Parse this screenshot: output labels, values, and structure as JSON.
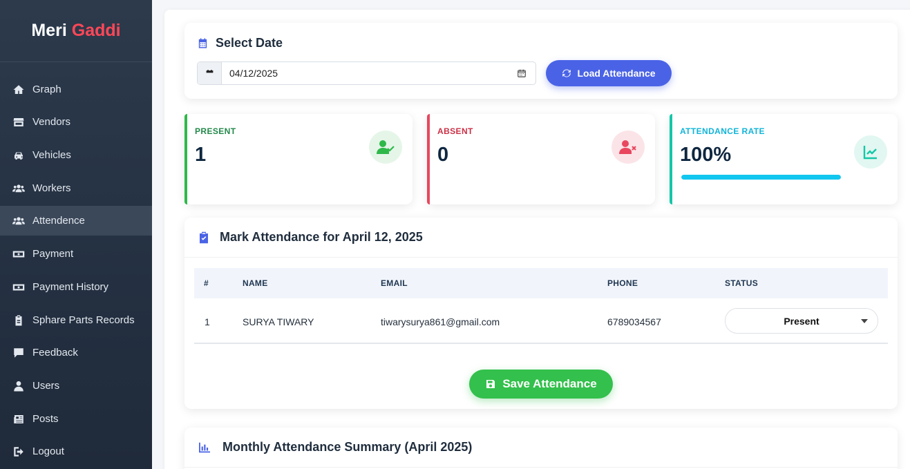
{
  "sidebar": {
    "brand_main": "Meri",
    "brand_accent": "Gaddi",
    "items": [
      {
        "label": "Graph",
        "icon": "home-icon"
      },
      {
        "label": "Vendors",
        "icon": "store-icon"
      },
      {
        "label": "Vehicles",
        "icon": "car-icon"
      },
      {
        "label": "Workers",
        "icon": "users-icon"
      },
      {
        "label": "Attendence",
        "icon": "users-icon",
        "active": true
      },
      {
        "label": "Payment",
        "icon": "money-icon"
      },
      {
        "label": "Payment History",
        "icon": "money-icon"
      },
      {
        "label": "Sphare Parts Records",
        "icon": "clipboard-icon"
      },
      {
        "label": "Feedback",
        "icon": "comment-icon"
      },
      {
        "label": "Users",
        "icon": "user-icon"
      },
      {
        "label": "Posts",
        "icon": "newspaper-icon"
      },
      {
        "label": "Logout",
        "icon": "logout-icon"
      }
    ]
  },
  "date_section": {
    "title": "Select Date",
    "date_value": "04/12/2025",
    "load_button": "Load Attendance"
  },
  "stats": {
    "present": {
      "label": "PRESENT",
      "value": "1",
      "color": "#2fb84a"
    },
    "absent": {
      "label": "ABSENT",
      "value": "0",
      "color": "#e8475f"
    },
    "rate": {
      "label": "ATTENDANCE RATE",
      "value": "100%",
      "percent": 100,
      "color": "#12c7ef"
    }
  },
  "mark_section": {
    "title": "Mark Attendance for April 12, 2025",
    "columns": [
      "#",
      "NAME",
      "EMAIL",
      "PHONE",
      "STATUS"
    ],
    "rows": [
      {
        "index": "1",
        "name": "SURYA TIWARY",
        "email": "tiwarysurya861@gmail.com",
        "phone": "6789034567",
        "status": "Present"
      }
    ],
    "save_button": "Save Attendance"
  },
  "summary_section": {
    "title": "Monthly Attendance Summary (April 2025)"
  }
}
